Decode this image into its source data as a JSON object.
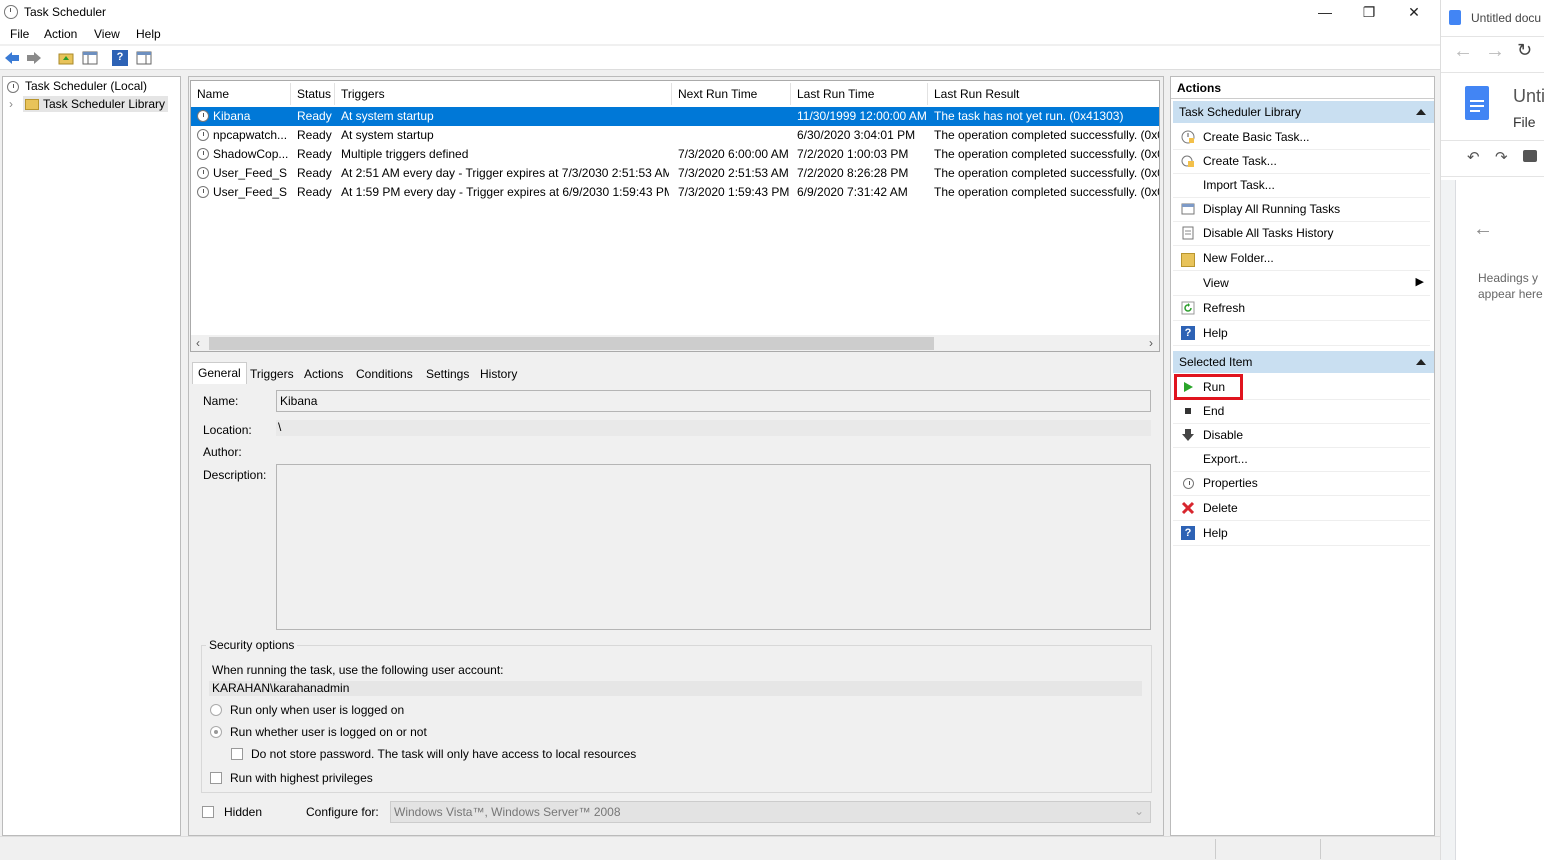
{
  "window": {
    "title": "Task Scheduler",
    "controls": [
      "—",
      "❐",
      "✕"
    ]
  },
  "menu": [
    "File",
    "Action",
    "View",
    "Help"
  ],
  "tree": {
    "root": "Task Scheduler (Local)",
    "library": "Task Scheduler Library"
  },
  "tasklist": {
    "columns": [
      "Name",
      "Status",
      "Triggers",
      "Next Run Time",
      "Last Run Time",
      "Last Run Result"
    ],
    "rows": [
      {
        "name": "Kibana",
        "status": "Ready",
        "triggers": "At system startup",
        "next": "",
        "last": "11/30/1999 12:00:00 AM",
        "result": "The task has not yet run. (0x41303)"
      },
      {
        "name": "npcapwatch...",
        "status": "Ready",
        "triggers": "At system startup",
        "next": "",
        "last": "6/30/2020 3:04:01 PM",
        "result": "The operation completed successfully. (0x0"
      },
      {
        "name": "ShadowCop...",
        "status": "Ready",
        "triggers": "Multiple triggers defined",
        "next": "7/3/2020 6:00:00 AM",
        "last": "7/2/2020 1:00:03 PM",
        "result": "The operation completed successfully. (0x0"
      },
      {
        "name": "User_Feed_S...",
        "status": "Ready",
        "triggers": "At 2:51 AM every day - Trigger expires at 7/3/2030 2:51:53 AM.",
        "next": "7/3/2020 2:51:53 AM",
        "last": "7/2/2020 8:26:28 PM",
        "result": "The operation completed successfully. (0x0"
      },
      {
        "name": "User_Feed_S...",
        "status": "Ready",
        "triggers": "At 1:59 PM every day - Trigger expires at 6/9/2030 1:59:43 PM.",
        "next": "7/3/2020 1:59:43 PM",
        "last": "6/9/2020 7:31:42 AM",
        "result": "The operation completed successfully. (0x0"
      }
    ]
  },
  "details": {
    "tabs": [
      "General",
      "Triggers",
      "Actions",
      "Conditions",
      "Settings",
      "History"
    ],
    "name_label": "Name:",
    "name_value": "Kibana",
    "location_label": "Location:",
    "location_value": "\\",
    "author_label": "Author:",
    "author_value": "",
    "description_label": "Description:",
    "security": {
      "legend": "Security options",
      "prompt": "When running the task, use the following user account:",
      "account": "KARAHAN\\karahanadmin",
      "opt1": "Run only when user is logged on",
      "opt2": "Run whether user is logged on or not",
      "opt3": "Do not store password.  The task will only have access to local resources",
      "opt4": "Run with highest privileges"
    },
    "hidden_label": "Hidden",
    "configure_label": "Configure for:",
    "configure_value": "Windows Vista™, Windows Server™ 2008"
  },
  "actions": {
    "header": "Actions",
    "library_section": "Task Scheduler Library",
    "library_items": [
      "Create Basic Task...",
      "Create Task...",
      "Import Task...",
      "Display All Running Tasks",
      "Disable All Tasks History",
      "New Folder...",
      "View",
      "Refresh",
      "Help"
    ],
    "selected_section": "Selected Item",
    "selected_items": [
      "Run",
      "End",
      "Disable",
      "Export...",
      "Properties",
      "Delete",
      "Help"
    ]
  },
  "gdoc": {
    "tab_title": "Untitled docu",
    "doc_title": "Unti",
    "menu_file": "File",
    "outline_text": "Headings y appear here"
  },
  "colors": {
    "selection": "#0078d7",
    "section_header": "#c9dff1",
    "highlight": "#e0141e"
  }
}
